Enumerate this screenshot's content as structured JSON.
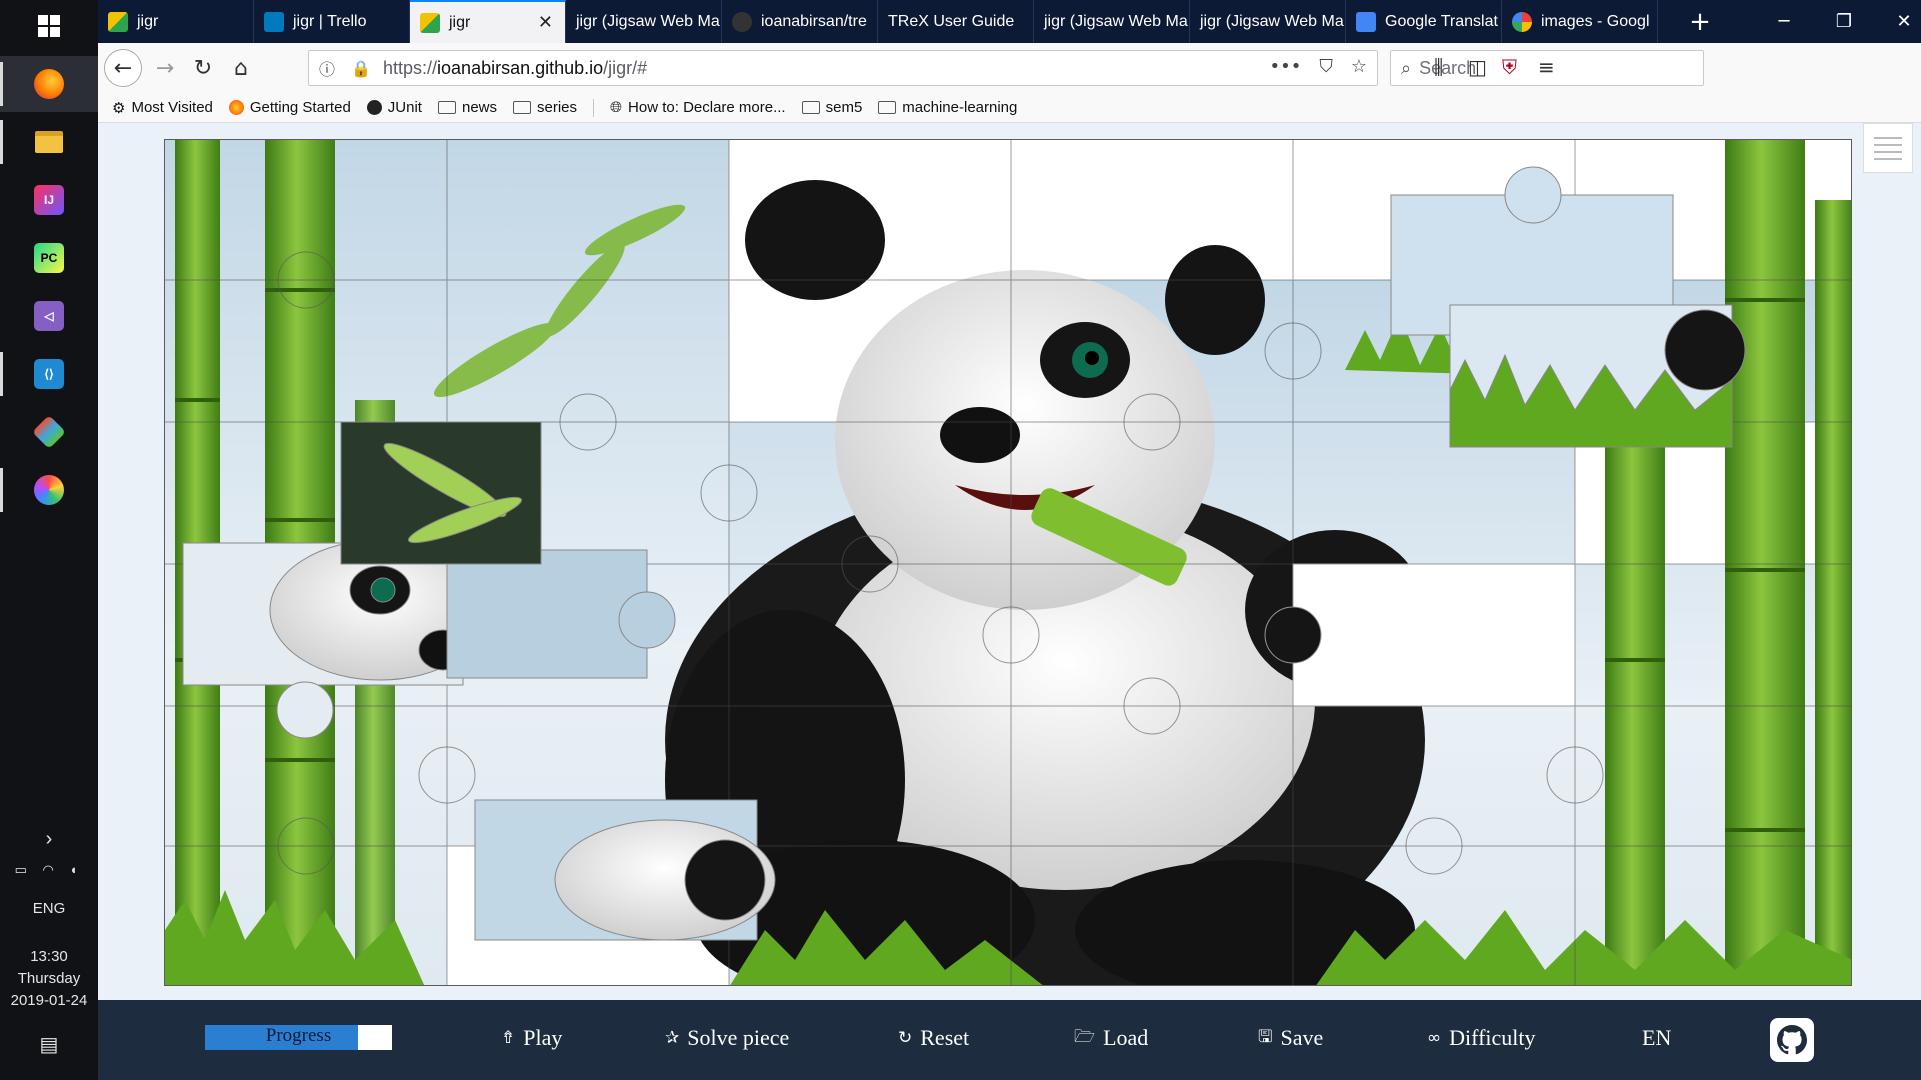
{
  "taskbar": {
    "apps": [
      {
        "name": "firefox-icon",
        "label": "Firefox"
      },
      {
        "name": "file-explorer-icon",
        "label": "File Explorer"
      },
      {
        "name": "intellij-icon",
        "label": "IJ"
      },
      {
        "name": "pycharm-icon",
        "label": "PC"
      },
      {
        "name": "visual-studio-icon",
        "label": "VS"
      },
      {
        "name": "vscode-icon",
        "label": "Code"
      },
      {
        "name": "gitkraken-icon",
        "label": "Git"
      },
      {
        "name": "paint-icon",
        "label": "Paint"
      }
    ],
    "language": "ENG",
    "time": "13:30",
    "day": "Thursday",
    "date": "2019-01-24"
  },
  "tabs": [
    {
      "title": "jigr",
      "favicon_color": "#f2c300"
    },
    {
      "title": "jigr | Trello",
      "favicon_color": "#0079bf"
    },
    {
      "title": "jigr",
      "favicon_color": "#f2c300",
      "active": true
    },
    {
      "title": "jigr (Jigsaw Web Ma",
      "favicon_color": ""
    },
    {
      "title": "ioanabirsan/tre",
      "favicon_color": "#333333"
    },
    {
      "title": "TReX User Guide",
      "favicon_color": ""
    },
    {
      "title": "jigr (Jigsaw Web Ma",
      "favicon_color": ""
    },
    {
      "title": "jigr (Jigsaw Web Ma",
      "favicon_color": ""
    },
    {
      "title": "Google Translat",
      "favicon_color": "#4285f4"
    },
    {
      "title": "images - Googl",
      "favicon_color": "#ffffff"
    }
  ],
  "address": {
    "scheme": "https://",
    "host": "ioanabirsan.github.io",
    "path": "/jigr/#"
  },
  "search": {
    "placeholder": "Search"
  },
  "bookmarks": [
    {
      "label": "Most Visited",
      "icon": "gear-icon"
    },
    {
      "label": "Getting Started",
      "icon": "firefox-icon"
    },
    {
      "label": "JUnit",
      "icon": "github-icon"
    },
    {
      "label": "news",
      "icon": "folder-icon"
    },
    {
      "label": "series",
      "icon": "folder-icon"
    },
    {
      "label": "How to: Declare more...",
      "icon": "globe-icon"
    },
    {
      "label": "sem5",
      "icon": "folder-icon"
    },
    {
      "label": "machine-learning",
      "icon": "folder-icon"
    }
  ],
  "game": {
    "progress_label": "Progress",
    "progress_fraction": 0.82,
    "buttons": [
      {
        "name": "play-button",
        "icon": "⇮",
        "label": "Play"
      },
      {
        "name": "solve-piece-button",
        "icon": "✰",
        "label": "Solve piece"
      },
      {
        "name": "reset-button",
        "icon": "↻",
        "label": "Reset"
      },
      {
        "name": "load-button",
        "icon": "🗁",
        "label": "Load"
      },
      {
        "name": "save-button",
        "icon": "🖫",
        "label": "Save"
      },
      {
        "name": "difficulty-button",
        "icon": "∞",
        "label": "Difficulty"
      },
      {
        "name": "language-button",
        "icon": "",
        "label": "EN"
      }
    ]
  },
  "colors": {
    "tabstrip": "#0c1a35",
    "gamebar": "#1d2c3e",
    "progress_fill": "#2a7fd1",
    "sky": "#cfe0ee",
    "bamboo": "#6aa62a",
    "grass": "#5fa81f"
  }
}
